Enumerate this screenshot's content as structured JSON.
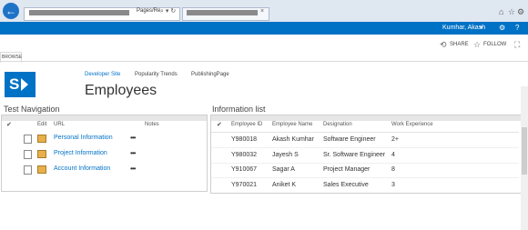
{
  "browser": {
    "address_suffix": "Pages/Re",
    "address_icons": "⌕ ▾ ↻",
    "tab_close": "×",
    "back": "←",
    "home_icon": "⌂",
    "favorites_icon": "☆",
    "settings_icon": "⚙"
  },
  "suite": {
    "user_name": "Kumhar, Akash",
    "caret": "▼",
    "help_icon": "?"
  },
  "actions": {
    "share": "SHARE",
    "follow": "FOLLOW"
  },
  "ribbon": {
    "browse": "BROWSE"
  },
  "site": {
    "nav": [
      "Developer Site",
      "Popularity Trends",
      "PublishingPage"
    ],
    "title": "Employees"
  },
  "test_navigation": {
    "title": "Test Navigation",
    "headers": {
      "check": "✔",
      "edit": "Edit",
      "url": "URL",
      "notes": "Notes"
    },
    "rows": [
      {
        "url": "Personal Information",
        "menu": "•••"
      },
      {
        "url": "Project Information",
        "menu": "•••"
      },
      {
        "url": "Account Information",
        "menu": "•••"
      }
    ]
  },
  "information_list": {
    "title": "Information list",
    "headers": {
      "check": "✔",
      "id": "Employee ID",
      "name": "Employee Name",
      "designation": "Designation",
      "experience": "Work Experience"
    },
    "rows": [
      {
        "id": "Y980018",
        "name": "Akash Kumhar",
        "designation": "Software Engineer",
        "experience": "2+"
      },
      {
        "id": "Y980032",
        "name": "Jayesh S",
        "designation": "Sr. Software Engineer",
        "experience": "4"
      },
      {
        "id": "Y910067",
        "name": "Sagar A",
        "designation": "Project Manager",
        "experience": "8"
      },
      {
        "id": "Y970021",
        "name": "Aniket K",
        "designation": "Sales Executive",
        "experience": "3"
      }
    ]
  },
  "colors": {
    "suite_bar": "#0072c6",
    "link": "#0072c6"
  }
}
